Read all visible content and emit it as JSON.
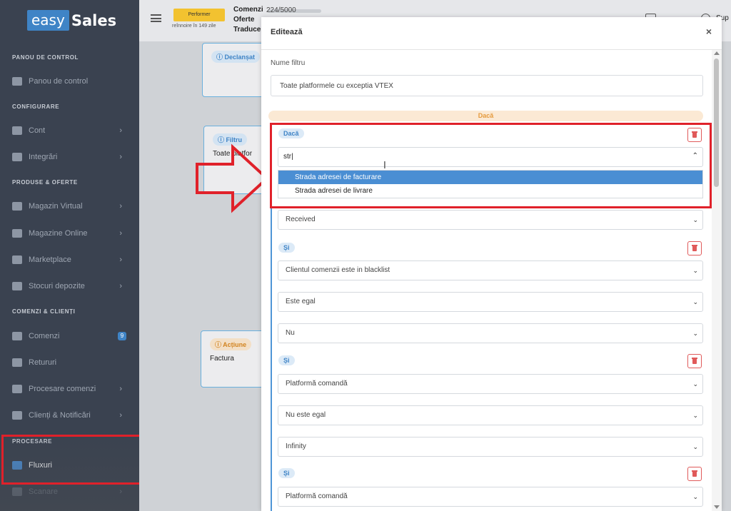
{
  "app": {
    "logo_easy": "easy",
    "logo_sales": "Sales"
  },
  "sidebar": {
    "sections": [
      {
        "title": "PANOU DE CONTROL"
      },
      {
        "title": "CONFIGURARE"
      },
      {
        "title": "PRODUSE & OFERTE"
      },
      {
        "title": "COMENZI & CLIENȚI"
      },
      {
        "title": "PROCESARE"
      }
    ],
    "items": [
      {
        "label": "Panou de control",
        "icon": "dashboard-icon"
      },
      {
        "label": "Cont",
        "icon": "user-icon"
      },
      {
        "label": "Integrări",
        "icon": "link-icon"
      },
      {
        "label": "Magazin Virtual",
        "icon": "store-icon"
      },
      {
        "label": "Magazine Online",
        "icon": "globe-icon"
      },
      {
        "label": "Marketplace",
        "icon": "marketplace-icon"
      },
      {
        "label": "Stocuri depozite",
        "icon": "boxes-icon"
      },
      {
        "label": "Comenzi",
        "icon": "tag-icon",
        "badge": "9"
      },
      {
        "label": "Retururi",
        "icon": "return-icon"
      },
      {
        "label": "Procesare comenzi",
        "icon": "process-icon"
      },
      {
        "label": "Clienți & Notificări",
        "icon": "users-icon"
      },
      {
        "label": "Fluxuri",
        "icon": "flow-icon"
      },
      {
        "label": "Scanare",
        "icon": "scan-icon"
      }
    ]
  },
  "topbar": {
    "plan_badge": "Performer",
    "renew_text": "reînnoire în 149 zile",
    "labels": [
      "Comenzi",
      "Oferte",
      "Traduce"
    ],
    "orders_count": "224/5000",
    "right_text": "Sup"
  },
  "canvas": {
    "trigger_pill": "Declanșat",
    "filter_pill": "Filtru",
    "filter_text": "Toate platfor",
    "action_pill": "Acțiune",
    "action_text": "Factura"
  },
  "modal": {
    "title": "Editează",
    "close": "×",
    "filter_name_label": "Nume filtru",
    "filter_name_value": "Toate platformele cu exceptia VTEX",
    "if_banner": "Dacă",
    "group_if_pill": "Dacă",
    "search_text": "str",
    "dropdown_options": [
      "Strada adresei de facturare",
      "Strada adresei de livrare"
    ],
    "received_value": "Received",
    "and_pill": "Și",
    "cond2": [
      "Clientul comenzii este in blacklist",
      "Este egal",
      "Nu"
    ],
    "cond3": [
      "Platformă comandă",
      "Nu este egal",
      "Infinity"
    ],
    "cond4": [
      "Platformă comandă"
    ]
  },
  "colors": {
    "accent": "#3f84c6",
    "highlight": "#e0212a",
    "sidebar_bg": "#3a4250",
    "warning": "#f2c230"
  }
}
